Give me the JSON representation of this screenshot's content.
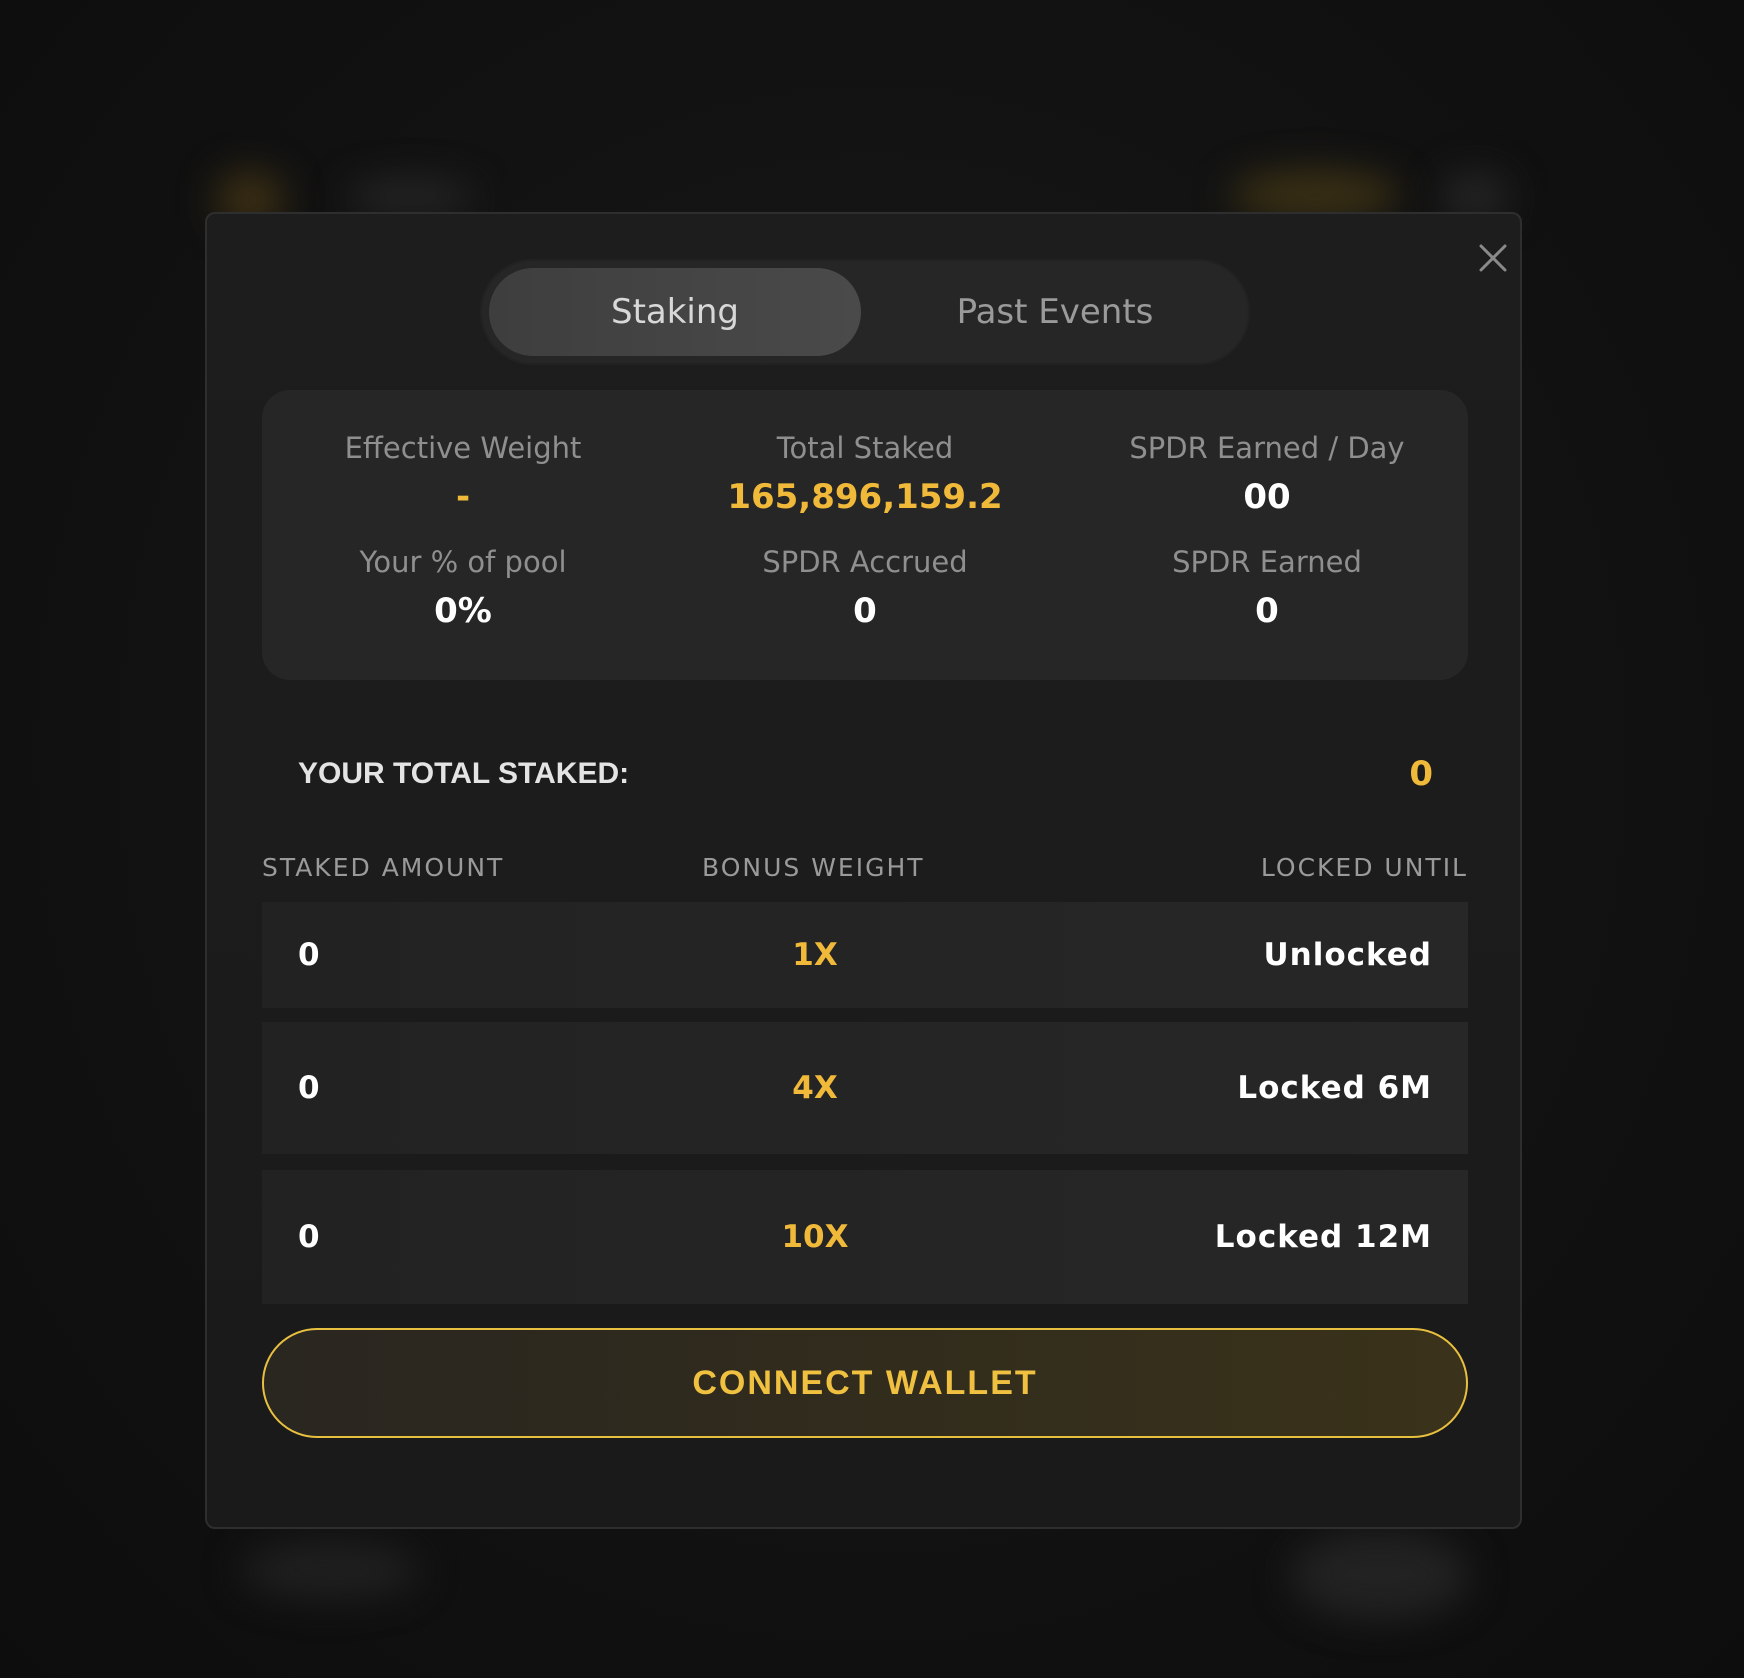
{
  "tabs": {
    "staking": "Staking",
    "past_events": "Past Events"
  },
  "stats": {
    "effective_weight": {
      "label": "Effective Weight",
      "value": "-"
    },
    "total_staked": {
      "label": "Total Staked",
      "value": "165,896,159.2"
    },
    "spdr_earned_day": {
      "label": "SPDR Earned / Day",
      "value": "00"
    },
    "pool_share": {
      "label": "Your % of pool",
      "value": "0%"
    },
    "spdr_accrued": {
      "label": "SPDR Accrued",
      "value": "0"
    },
    "spdr_earned": {
      "label": "SPDR Earned",
      "value": "0"
    }
  },
  "your_total": {
    "label": "YOUR TOTAL STAKED:",
    "value": "0"
  },
  "table": {
    "headers": {
      "amount": "STAKED AMOUNT",
      "bonus": "BONUS WEIGHT",
      "locked": "LOCKED UNTIL"
    },
    "rows": [
      {
        "amount": "0",
        "weight": "1X",
        "lock": "Unlocked"
      },
      {
        "amount": "0",
        "weight": "4X",
        "lock": "Locked 6M"
      },
      {
        "amount": "0",
        "weight": "10X",
        "lock": "Locked 12M"
      }
    ]
  },
  "connect_label": "CONNECT WALLET",
  "colors": {
    "accent": "#f0b93a",
    "background": "#111111",
    "panel": "#262626"
  },
  "icons": {
    "close": "close-icon"
  }
}
